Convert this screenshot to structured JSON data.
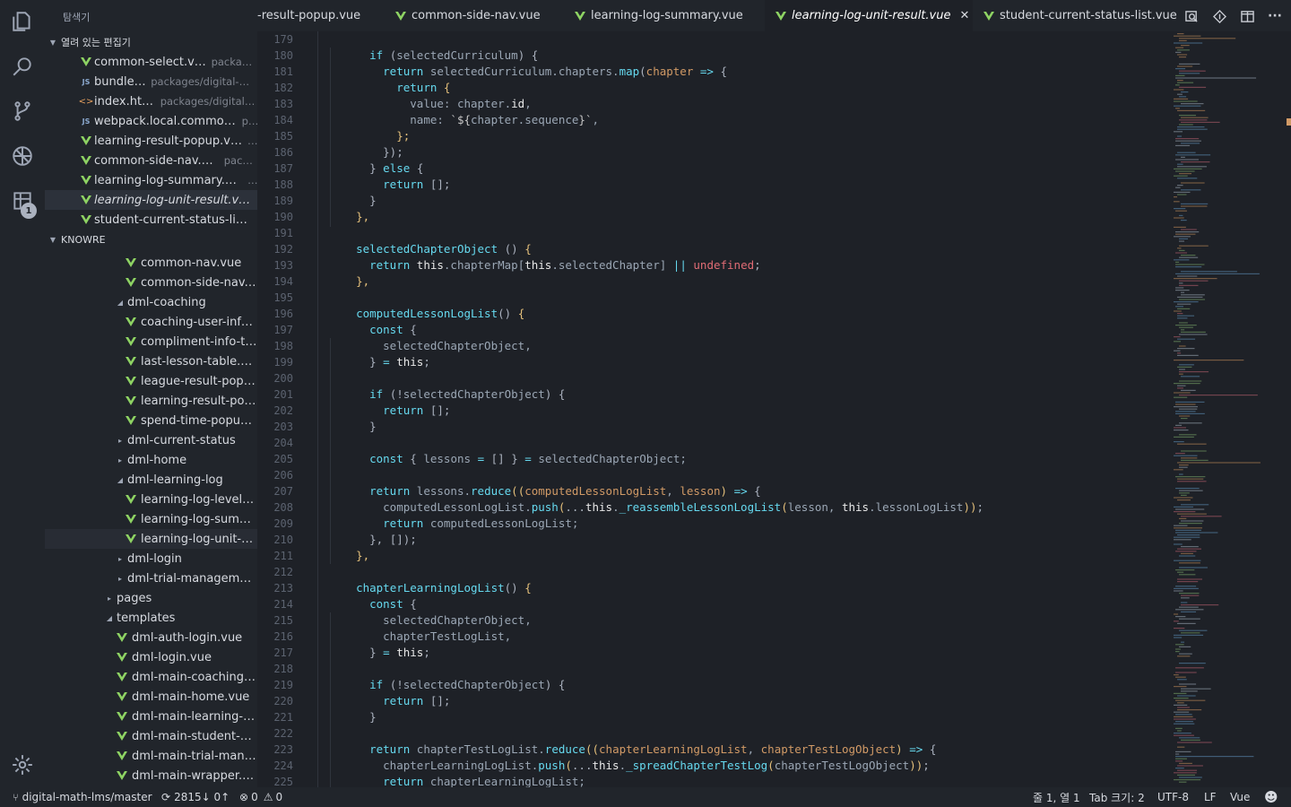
{
  "explorer": {
    "title": "탐색기",
    "open_editors": {
      "label": "열려 있는 편집기",
      "items": [
        {
          "name": "common-select.vue",
          "path": "packag...",
          "icon": "vue-icon"
        },
        {
          "name": "bundle.js",
          "path": "packages/digital-m...",
          "icon": "js-icon"
        },
        {
          "name": "index.html",
          "path": "packages/digital-...",
          "icon": "html-icon"
        },
        {
          "name": "webpack.local.common.js",
          "path": "p...",
          "icon": "js-icon"
        },
        {
          "name": "learning-result-popup.vue",
          "path": "...",
          "icon": "vue-icon"
        },
        {
          "name": "common-side-nav.vue",
          "path": "pack...",
          "icon": "vue-icon"
        },
        {
          "name": "learning-log-summary.vue",
          "path": "...",
          "icon": "vue-icon"
        },
        {
          "name": "learning-log-unit-result.vue...",
          "path": "",
          "icon": "vue-icon"
        },
        {
          "name": "student-current-status-list....",
          "path": "",
          "icon": "vue-icon"
        }
      ]
    },
    "workspace": {
      "label": "KNOWRE",
      "items": [
        {
          "name": "common-nav.vue",
          "type": "vue"
        },
        {
          "name": "common-side-nav....",
          "type": "vue"
        },
        {
          "name": "dml-coaching",
          "type": "folder-open"
        },
        {
          "name": "coaching-user-info...",
          "type": "vue"
        },
        {
          "name": "compliment-info-ta...",
          "type": "vue"
        },
        {
          "name": "last-lesson-table.vu...",
          "type": "vue"
        },
        {
          "name": "league-result-popu...",
          "type": "vue"
        },
        {
          "name": "learning-result-pop...",
          "type": "vue"
        },
        {
          "name": "spend-time-popup....",
          "type": "vue"
        },
        {
          "name": "dml-current-status",
          "type": "folder"
        },
        {
          "name": "dml-home",
          "type": "folder"
        },
        {
          "name": "dml-learning-log",
          "type": "folder-open"
        },
        {
          "name": "learning-log-level-r...",
          "type": "vue"
        },
        {
          "name": "learning-log-summ...",
          "type": "vue"
        },
        {
          "name": "learning-log-unit-re...",
          "type": "vue"
        },
        {
          "name": "dml-login",
          "type": "folder"
        },
        {
          "name": "dml-trial-management",
          "type": "folder"
        },
        {
          "name": "pages",
          "type": "folder"
        },
        {
          "name": "templates",
          "type": "folder-open"
        },
        {
          "name": "dml-auth-login.vue",
          "type": "vue"
        },
        {
          "name": "dml-login.vue",
          "type": "vue"
        },
        {
          "name": "dml-main-coaching.v...",
          "type": "vue"
        },
        {
          "name": "dml-main-home.vue",
          "type": "vue"
        },
        {
          "name": "dml-main-learning-lo...",
          "type": "vue"
        },
        {
          "name": "dml-main-student-cu...",
          "type": "vue"
        },
        {
          "name": "dml-main-trial-manag...",
          "type": "vue"
        },
        {
          "name": "dml-main-wrapper.vue",
          "type": "vue"
        }
      ]
    }
  },
  "activity_badge": "1",
  "tabs": [
    {
      "label": "-result-popup.vue"
    },
    {
      "label": "common-side-nav.vue"
    },
    {
      "label": "learning-log-summary.vue"
    },
    {
      "label": "learning-log-unit-result.vue",
      "active": true
    },
    {
      "label": "student-current-status-list.vue"
    }
  ],
  "editor": {
    "line_numbers": [
      "179",
      "180",
      "181",
      "182",
      "183",
      "184",
      "185",
      "186",
      "187",
      "188",
      "189",
      "190",
      "191",
      "192",
      "193",
      "194",
      "195",
      "196",
      "197",
      "198",
      "199",
      "200",
      "201",
      "202",
      "203",
      "204",
      "205",
      "206",
      "207",
      "208",
      "209",
      "210",
      "211",
      "212",
      "213",
      "214",
      "215",
      "216",
      "217",
      "218",
      "219",
      "220",
      "221",
      "222",
      "223",
      "224",
      "225"
    ]
  },
  "status": {
    "branch": "digital-math-lms/master",
    "sync": "2815↓ 0↑",
    "errors": "0",
    "warnings": "0",
    "cursor": "줄 1, 열 1",
    "tab_size": "Tab 크기: 2",
    "encoding": "UTF-8",
    "eol": "LF",
    "language": "Vue"
  },
  "colors": {
    "background": "#1e2127",
    "sidebar": "#21252b",
    "vue_green": "#8ed363",
    "keyword": "#66d9ef",
    "property": "#e06c75"
  }
}
